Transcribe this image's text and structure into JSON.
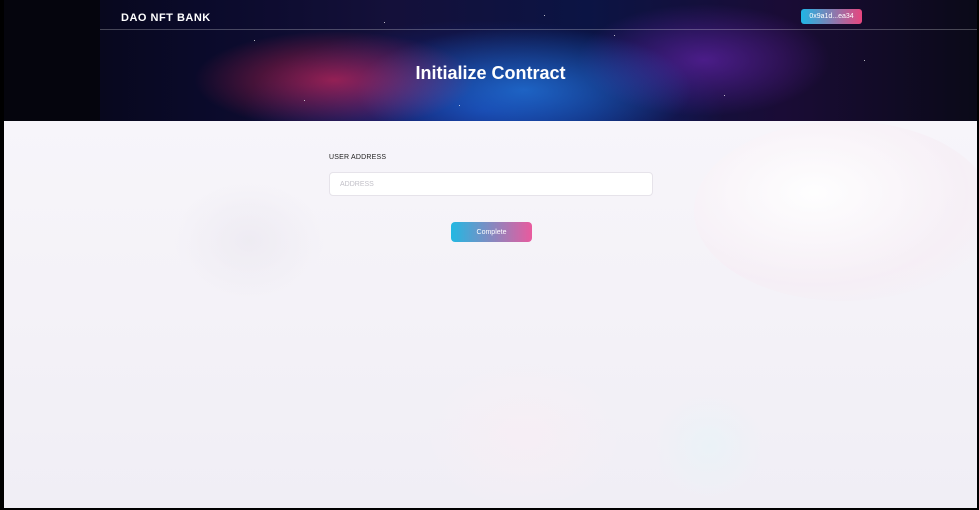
{
  "header": {
    "brand": "DAO NFT BANK",
    "wallet_address": "0x9a1d...ea34",
    "page_title": "Initialize Contract"
  },
  "form": {
    "user_address_label": "USER ADDRESS",
    "address_placeholder": "ADDRESS",
    "address_value": "",
    "complete_label": "Complete"
  },
  "colors": {
    "accent_start": "#22b8e2",
    "accent_end": "#e95a9e",
    "page_background": "#f5f3f8",
    "header_background": "#0b1444"
  }
}
